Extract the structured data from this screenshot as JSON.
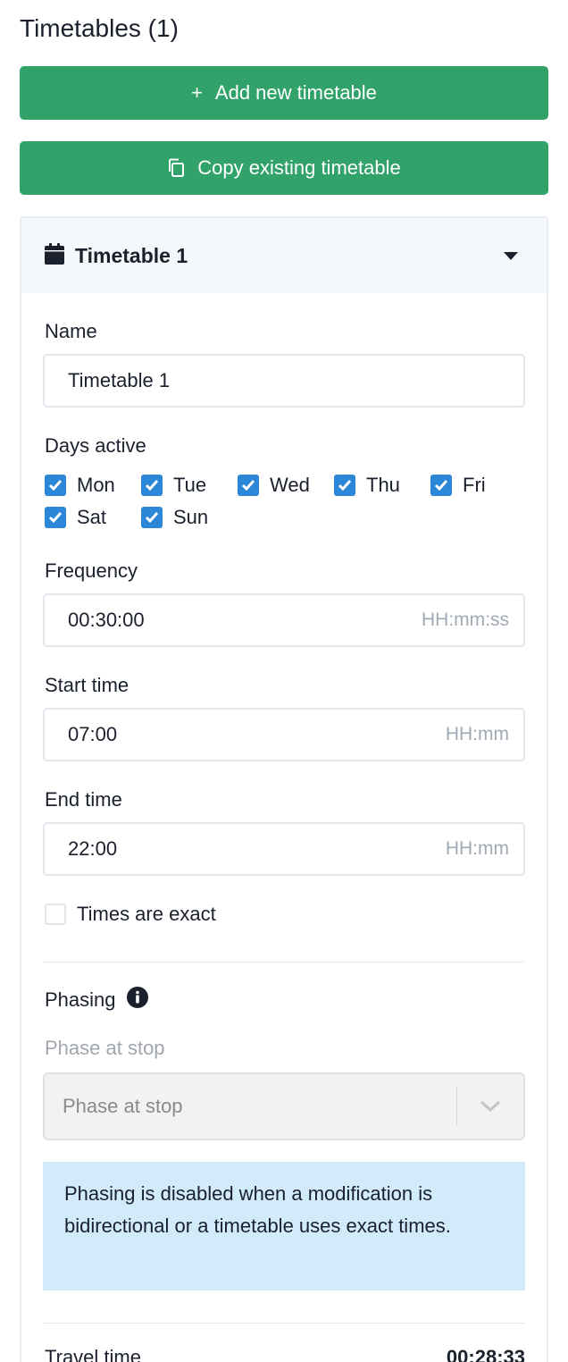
{
  "heading": "Timetables (1)",
  "buttons": {
    "add": "Add new timetable",
    "copy": "Copy existing timetable"
  },
  "timetable": {
    "title": "Timetable 1",
    "name_label": "Name",
    "name_value": "Timetable 1",
    "days_label": "Days active",
    "days": [
      {
        "label": "Mon",
        "checked": true
      },
      {
        "label": "Tue",
        "checked": true
      },
      {
        "label": "Wed",
        "checked": true
      },
      {
        "label": "Thu",
        "checked": true
      },
      {
        "label": "Fri",
        "checked": true
      },
      {
        "label": "Sat",
        "checked": true
      },
      {
        "label": "Sun",
        "checked": true
      }
    ],
    "frequency_label": "Frequency",
    "frequency_value": "00:30:00",
    "frequency_unit": "HH:mm:ss",
    "start_label": "Start time",
    "start_value": "07:00",
    "start_unit": "HH:mm",
    "end_label": "End time",
    "end_value": "22:00",
    "end_unit": "HH:mm",
    "exact_label": "Times are exact",
    "exact_checked": false,
    "phasing_label": "Phasing",
    "phase_at_stop_label": "Phase at stop",
    "phase_at_stop_placeholder": "Phase at stop",
    "phasing_alert": "Phasing is disabled when a modification is bidirectional or a timetable uses exact times.",
    "travel_time_label": "Travel time",
    "travel_time_value": "00:28:33"
  },
  "colors": {
    "button_green": "#31a26a",
    "checkbox_blue": "#2d87d8",
    "alert_bg": "#d1ebfb"
  },
  "icons": {
    "add": "plus-icon",
    "copy": "copy-icon",
    "calendar": "calendar-icon",
    "collapse": "caret-down-icon",
    "info": "info-icon",
    "select": "chevron-down-icon"
  }
}
